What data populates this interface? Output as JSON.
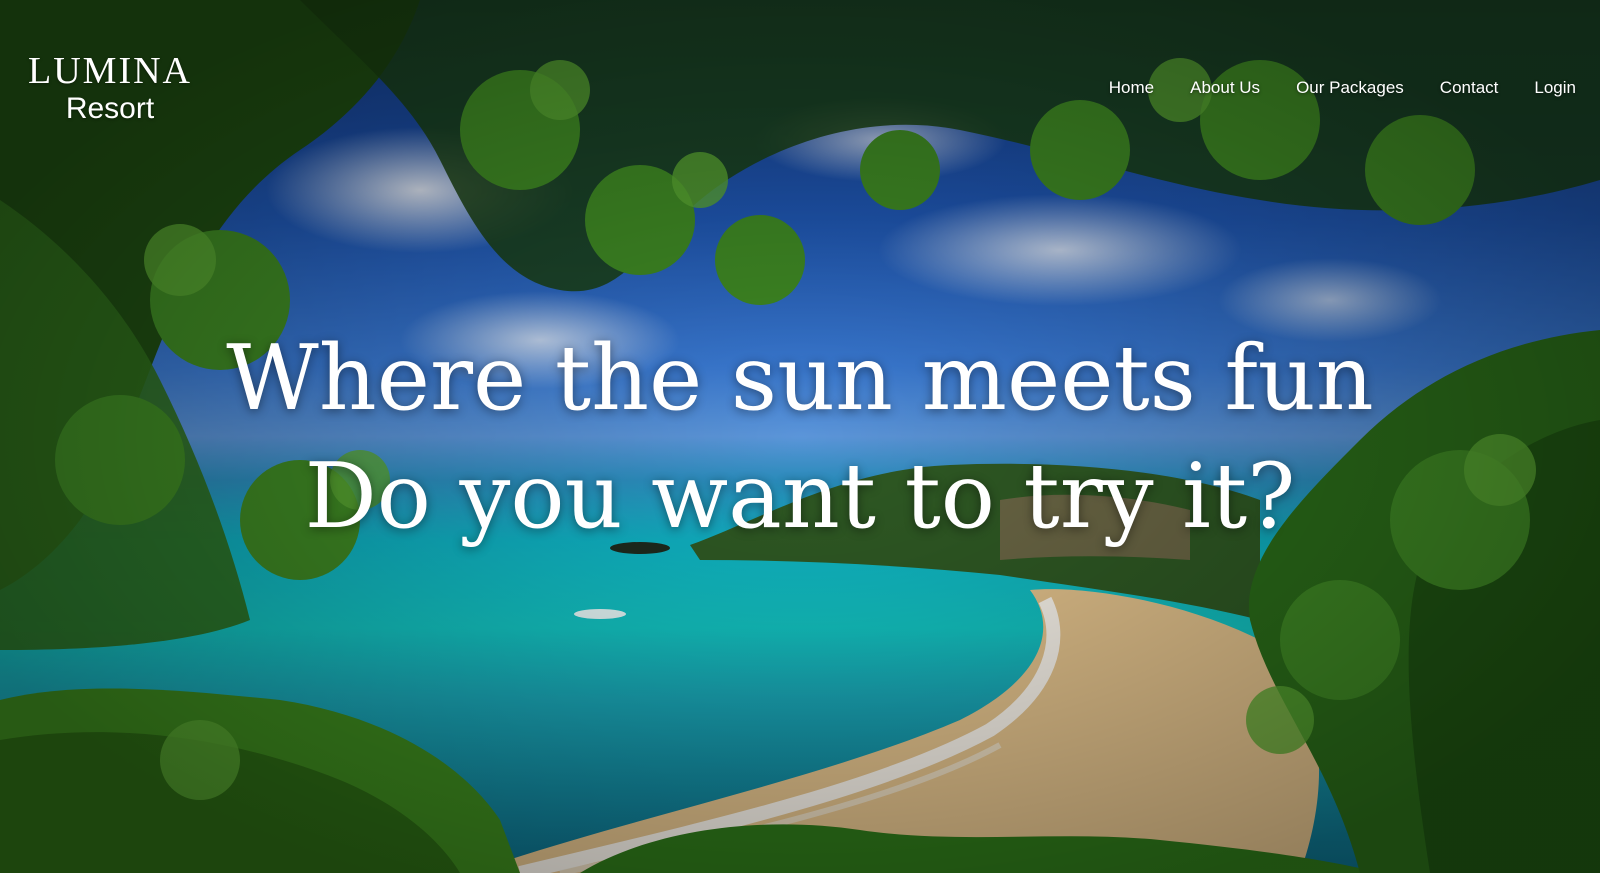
{
  "brand": {
    "name": "LUMINA",
    "tagline": "Resort"
  },
  "nav": {
    "items": [
      {
        "label": "Home"
      },
      {
        "label": "About Us"
      },
      {
        "label": "Our Packages"
      },
      {
        "label": "Contact"
      },
      {
        "label": "Login"
      }
    ]
  },
  "hero": {
    "line1": "Where the sun meets fun",
    "line2": "Do you want to try it?"
  },
  "colors": {
    "text": "#ffffff",
    "sky": "#1f57b3",
    "sea": "#13c6c4",
    "sand": "#e6c58e",
    "foliage": "#2f6e1c"
  }
}
